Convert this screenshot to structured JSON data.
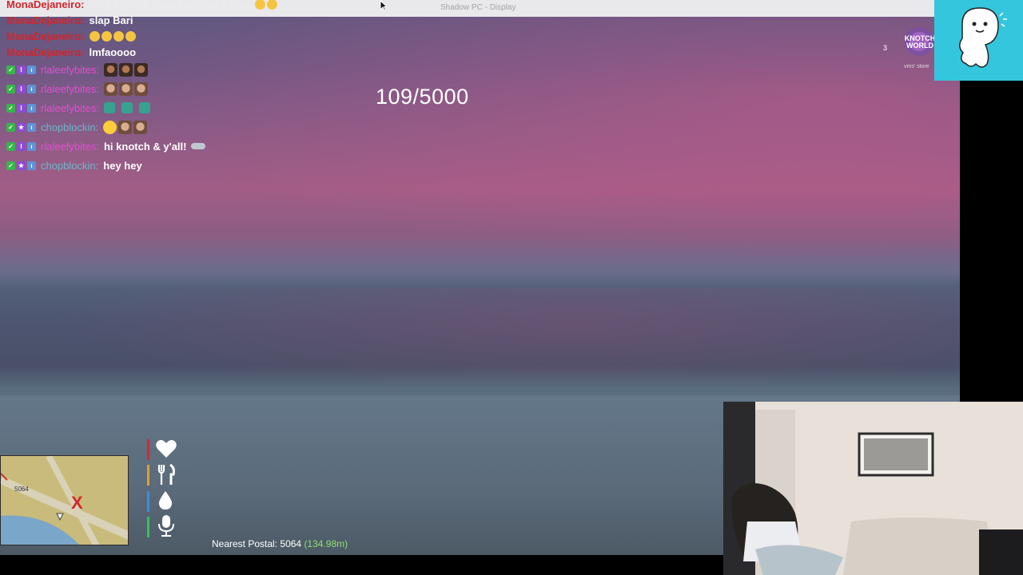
{
  "window": {
    "title": "Shadow PC - Display"
  },
  "chat": [
    {
      "user": "MonaDejaneiro",
      "user_color": "#d2252c",
      "text": "Ain't a Waffle House without a brawl"
    },
    {
      "user": "MonaDejaneiro",
      "user_color": "#d2252c",
      "text": "slap Bari"
    },
    {
      "user": "MonaDejaneiro",
      "user_color": "#d2252c",
      "text": ""
    },
    {
      "user": "MonaDejaneiro",
      "user_color": "#d2252c",
      "text": "lmfaoooo"
    },
    {
      "user": "rlaleefybites",
      "user_color": "#e64bd6",
      "text": ""
    },
    {
      "user": "rlaleefybites",
      "user_color": "#e64bd6",
      "text": ""
    },
    {
      "user": "rlaleefybites",
      "user_color": "#e64bd6",
      "text": ""
    },
    {
      "user": "chopblockin",
      "user_color": "#6db7c9",
      "text": ""
    },
    {
      "user": "rlaleefybites",
      "user_color": "#e64bd6",
      "text": "hi knotch & y'all!"
    },
    {
      "user": "chopblockin",
      "user_color": "#6db7c9",
      "text": "hey hey"
    }
  ],
  "hud": {
    "counter": "109/5000",
    "postal_label": "Nearest Postal:",
    "postal_code": "5064",
    "postal_distance": "(134.98m)",
    "minimap_postal": "5064"
  },
  "overlay": {
    "logo_text": "KNOTCH WORLD",
    "count": "3",
    "sub": "vms' store"
  },
  "icons": [
    "heart-icon",
    "fork-knife-icon",
    "water-drop-icon",
    "microphone-icon"
  ],
  "colors": {
    "health": "#d1283a",
    "hunger": "#e0a030",
    "thirst": "#3a8ee0",
    "voice": "#39c05a",
    "mascot_bg": "#34c6dc"
  }
}
